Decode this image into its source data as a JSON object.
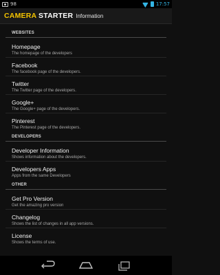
{
  "status_bar": {
    "left_text": "98",
    "time": "17:57",
    "icons": [
      "notification-icon",
      "wifi-icon",
      "battery-icon"
    ]
  },
  "action_bar": {
    "logo_part1": "CAMERA",
    "logo_part2": "STARTER",
    "title": "Information",
    "logo_colors": {
      "part1": "#f5c400",
      "part2": "#ffffff"
    }
  },
  "sections": {
    "websites": "WEBSITES",
    "developers": "DEVELOPERS",
    "other": "OTHER"
  },
  "items": {
    "homepage": {
      "title": "Homepage",
      "subtitle": "The homepage of the developers"
    },
    "facebook": {
      "title": "Facebook",
      "subtitle": "The facebook page of the developers."
    },
    "twitter": {
      "title": "Twitter",
      "subtitle": "The Twitter page of the developers."
    },
    "googleplus": {
      "title": "Google+",
      "subtitle": "The Google+ page of the developers."
    },
    "pinterest": {
      "title": "Pinterest",
      "subtitle": "The Pinterest page of the developers."
    },
    "developer_information": {
      "title": "Developer Information",
      "subtitle": "Shows information about the developers."
    },
    "developers_apps": {
      "title": "Developers Apps",
      "subtitle": "Apps from the same Developers"
    },
    "get_pro_version": {
      "title": "Get Pro Version",
      "subtitle": "Get the amazing pro version"
    },
    "changelog": {
      "title": "Changelog",
      "subtitle": "Shows the list of changes in all app versions."
    },
    "license": {
      "title": "License",
      "subtitle": "Shows the terms of use."
    }
  },
  "nav_bar": {
    "buttons": [
      "back-icon",
      "home-icon",
      "recent-apps-icon"
    ]
  },
  "colors": {
    "accent": "#33b5e5",
    "background": "#101010"
  }
}
